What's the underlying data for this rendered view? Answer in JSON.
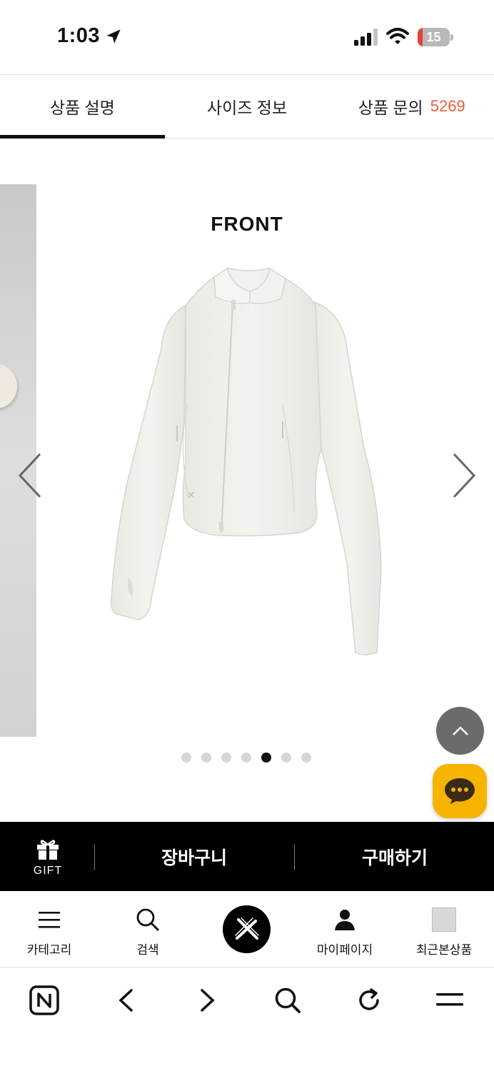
{
  "status": {
    "time": "1:03",
    "battery": "15",
    "battery_level": 0.15,
    "colors": {
      "battery_low": "#e5403a"
    }
  },
  "tabs": [
    {
      "label": "상품 설명",
      "active": true
    },
    {
      "label": "사이즈 정보",
      "active": false
    },
    {
      "label": "상품 문의",
      "count": "5269",
      "active": false
    }
  ],
  "accent_color": "#e5603c",
  "slide": {
    "title": "FRONT",
    "total": 7,
    "current": 5
  },
  "purchase_bar": {
    "gift_label": "GIFT",
    "cart_label": "장바구니",
    "buy_label": "구매하기"
  },
  "bottom_nav": {
    "category": "카테고리",
    "search": "검색",
    "mypage": "마이페이지",
    "recent": "최근본상품"
  },
  "icons": {
    "browser": [
      "naver-n-icon",
      "back-icon",
      "forward-icon",
      "search-icon",
      "reload-icon",
      "menu-icon"
    ]
  }
}
